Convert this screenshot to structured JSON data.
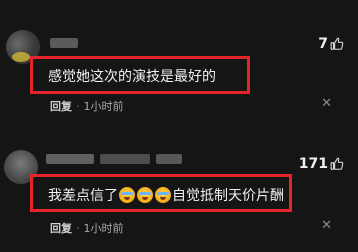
{
  "comments": [
    {
      "text": "感觉她这次的演技是最好的",
      "likes": "7",
      "reply_label": "回复",
      "separator": "·",
      "time": "1小时前",
      "dismiss": "✕"
    },
    {
      "text_before": "我差点信了",
      "text_after": "自觉抵制天价片酬",
      "emojis": [
        "crying-laughing-emoji",
        "crying-laughing-emoji",
        "crying-laughing-emoji"
      ],
      "likes": "171",
      "reply_label": "回复",
      "separator": "·",
      "time": "1小时前",
      "dismiss": "✕"
    }
  ],
  "colors": {
    "background": "#151515",
    "highlight_box": "#e4232b",
    "text": "#f0f0f0",
    "meta": "#a8a8a8"
  },
  "icons": [
    "thumbs-up-icon",
    "close-icon"
  ]
}
